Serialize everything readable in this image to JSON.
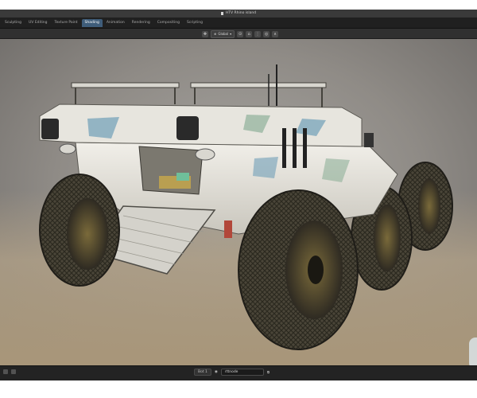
{
  "window": {
    "title": "HTV Rhino island"
  },
  "tabs": [
    {
      "label": "Sculpting",
      "active": false
    },
    {
      "label": "UV Editing",
      "active": false
    },
    {
      "label": "Texture Paint",
      "active": false
    },
    {
      "label": "Shading",
      "active": true
    },
    {
      "label": "Animation",
      "active": false
    },
    {
      "label": "Rendering",
      "active": false
    },
    {
      "label": "Compositing",
      "active": false
    },
    {
      "label": "Scripting",
      "active": false
    }
  ],
  "header": {
    "orientation": "Global"
  },
  "statusbar": {
    "frame": "Bot 1",
    "object": "rttnode"
  },
  "colors": {
    "active_tab": "#3f5d7a",
    "panel_dark": "#202020",
    "viewport_top": "#a7a5a1",
    "viewport_floor": "#a89679",
    "rover_hull": "#e8e6df",
    "camo_blue": "#6f9fb8",
    "camo_green": "#8fb09a",
    "tire": "#4a4538"
  },
  "icons": [
    "file-icon",
    "transform-icon",
    "orientation-icon",
    "pivot-icon",
    "snap-icon",
    "snap-settings-icon",
    "proportional-icon",
    "falloff-icon"
  ]
}
